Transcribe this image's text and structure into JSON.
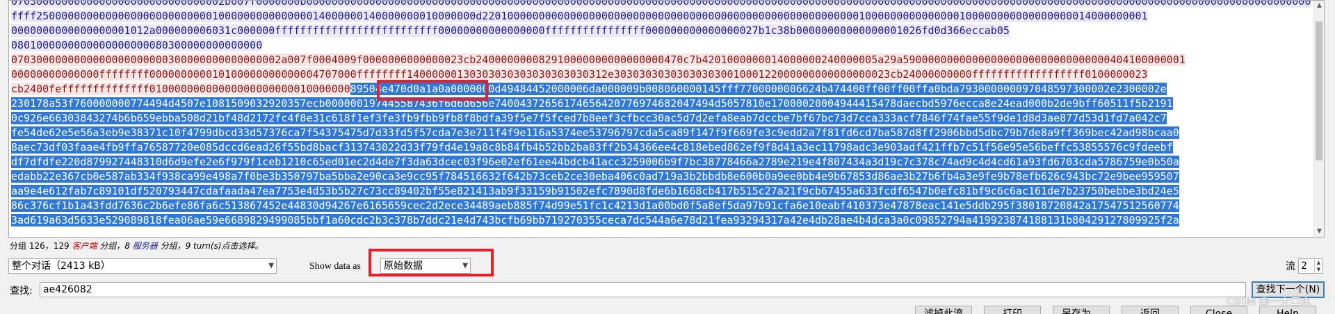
{
  "hex_stream": {
    "lines": [
      [
        {
          "t": "0703000000000000000000000000000002b007f0000000b0000000000000000000000000000000000000000000000000000000000000000000000000000000000000000000000000000000000000000000000000000000000000000000000000000000000000000",
          "c": "server"
        }
      ],
      [
        {
          "t": "ffff2500000000000000000000000000100000000000000014000000140000000010000000d2201000000000000000000000000000000000000000000000000000000001000000000000000100000000000000000014000000001",
          "c": "server"
        }
      ],
      [
        {
          "t": "0000000000000000001012a000000006031c000000ffffffffffffffffffffffffff00000000000000000ffffffffffffffff000000000000000027b1c38b00000000000000001026fd0d366eccab05",
          "c": "server"
        }
      ],
      [
        {
          "t": "0801000000000000000000080300000000000000",
          "c": "server"
        }
      ],
      [
        {
          "t": "0703000000000000000000000300000000000000002a007f0004009f0000000000000023cb240000000082910000000000000000470c7b4201000000014000000240000005a29a590000000000000000000000000000000404100000001",
          "c": "client"
        }
      ],
      [
        {
          "t": "00000000000000ffffffff000000000010100000000000004707000ffffffff14000000130303030303030303030312e30303030303030303001000122000000000000000023cb24000000000ffffffffffffffffff0100000023",
          "c": "client"
        }
      ],
      [
        {
          "t": "cb2400feffffffffffffff01000000000000000000000010000000",
          "c": "client"
        },
        {
          "t": "89504e470d0a1a0a0000000d49484452000006da000009b008060000145fff7700000006624b474400ff00ff00ffa0bda793000000097048597300002e2300002e",
          "c": "sel"
        }
      ],
      [
        {
          "t": "230178a53f760000000774494d4507e1081509032920357ecb000000197445587436f6d6d656e74004372656174656420776974682047494d5057810e17000020004944415478daecbd5976ecca8e24ead000b2de9bff60511f5b2191",
          "c": "sel"
        }
      ],
      [
        {
          "t": "0c926e66303843274b6b659ebba508d21bf48d2172fc4f8e31c618f1ef3fe3fb9fbb9fb8f8bdfa39f5e7f5fced7b8eef3cfbcc30ac5d7d2efa8eab7dccbe7bf67bc73d7cca333acf7846f74fae55f9de1d8d3ae877d53d1fd7a042c7",
          "c": "sel"
        }
      ],
      [
        {
          "t": "fe54de62e5e56a3eb9e38371c10f4799dbcd33d57376ca7f54375475d7d33fd5f57cda7e3e711f4f9e116a5374ee53796797cda5ca89f147f9f669fe3c9edd2a7f81fd6cd7ba587d8ff2906bbd5dbc79b7de8a9ff369bec42ad98bcaa0",
          "c": "sel"
        }
      ],
      [
        {
          "t": "8aec73df03faae4fb9ffa76587720e085dccd6ead26f55bd8bacf313743022d33f79fd4e19a8c8b84fb4b52bb2ba83ff2b34366ee4c818ebed862ef9f8d41a3ec11798adc3e903adf421ffb7c51f56e95e56beffc53855576c9fdeebf",
          "c": "sel"
        }
      ],
      [
        {
          "t": "df7dfdfe220d879927448310d6d9efe2e6f979f1ceb1210c65ed01ec2d4de7f3da63dcec03f96e02ef61ee44bdcb41acc3259006b9f7bc38778466a2789e219e4f807434a3d19c7c378c74ad9c4d4cd61a93fd6703cda5786759e0b50a",
          "c": "sel"
        }
      ],
      [
        {
          "t": "edabb22e367cb0e587ab334f938ca99e498a7f0be3b350797ba5bba2e90ca3e9cc95f784516632f642b73ceb2ce30eba406c0ad719a3b2bbdb8e600b0a9ee0bb4e9b67853d86ae3b27b6fb4a3e9fe9b78efb626c943bc72e9bee959507",
          "c": "sel"
        }
      ],
      [
        {
          "t": "aa9e4e612fab7c89101df520793447cdafaada47ea7753e4d53b5b27c73cc89402bf55e821413ab9f33159b91502efc7890d8fde6b1668cb417b515c27a21f9cb67455a633fcdf6547b0efc81bf9c6c6ac161de7b23750bebbe3bd24e5",
          "c": "sel"
        }
      ],
      [
        {
          "t": "86c376cf1b1a43fdd7636c2b6efe86fa6c513867452e44830d94267e6165659cec2d2ece34489aeb885f74d99e51fc1c4213d1a00bd0f5a8ef5da97b91cfa6e10eabf410373e47878eac141e5ddb295f38018720842a17547512560774",
          "c": "sel"
        }
      ],
      [
        {
          "t": "3ad619a63d5633e529089818fea06ae59e6689829499085bbf1a60cdc2b3c378b7ddc21e4d743bcfb69bb719270355ceca7dc544a6e78d21fea93294317a42e4db28ae4b4dca3a0c09852794a419923874188131b80429127809925f2a",
          "c": "sel"
        }
      ]
    ]
  },
  "status": {
    "prefix": "分组 126，129 ",
    "client_word": "客户端",
    "mid1": " 分组，8 ",
    "server_word": "服务器",
    "mid2": " 分组，9 turn(s)",
    "suffix": "点击选择。"
  },
  "conversation": {
    "selected": "整个对话（2413 kB）"
  },
  "show_data": {
    "label": "Show data as",
    "selected": "原始数据"
  },
  "stream": {
    "label": "流",
    "value": "2"
  },
  "find": {
    "label": "查找:",
    "value": "ae426082",
    "next_button": "查找下一个(N)"
  },
  "bottom_buttons": [
    "滤掉此流",
    "打印",
    "另存为…",
    "返回",
    "Close",
    "Help"
  ],
  "watermark": "CSDN @一大口水",
  "highlight_text": "89504e470d0a1a",
  "colors": {
    "selection": "#3078d6",
    "client_bg": "#f6e6e6",
    "server_bg": "#ece9f4",
    "annotation": "#e8202a"
  }
}
